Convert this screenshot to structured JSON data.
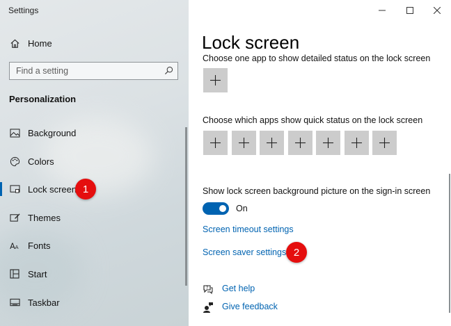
{
  "app_title": "Settings",
  "sidebar": {
    "home_label": "Home",
    "search_placeholder": "Find a setting",
    "section_title": "Personalization",
    "items": [
      {
        "label": "Background",
        "icon": "image-icon"
      },
      {
        "label": "Colors",
        "icon": "palette-icon"
      },
      {
        "label": "Lock screen",
        "icon": "lock-screen-icon",
        "active": true
      },
      {
        "label": "Themes",
        "icon": "themes-icon"
      },
      {
        "label": "Fonts",
        "icon": "fonts-icon"
      },
      {
        "label": "Start",
        "icon": "start-icon"
      },
      {
        "label": "Taskbar",
        "icon": "taskbar-icon"
      }
    ]
  },
  "main": {
    "page_title": "Lock screen",
    "detailed_status_text": "Choose one app to show detailed status on the lock screen",
    "quick_status_text": "Choose which apps show quick status on the lock screen",
    "quick_status_count": 7,
    "signin_bg_text": "Show lock screen background picture on the sign-in screen",
    "toggle_state": "On",
    "screen_timeout_link": "Screen timeout settings",
    "screen_saver_link": "Screen saver settings",
    "get_help": "Get help",
    "give_feedback": "Give feedback"
  },
  "annotations": {
    "badge1": "1",
    "badge2": "2"
  },
  "colors": {
    "accent": "#0063b1",
    "badge": "#e50e0e"
  }
}
